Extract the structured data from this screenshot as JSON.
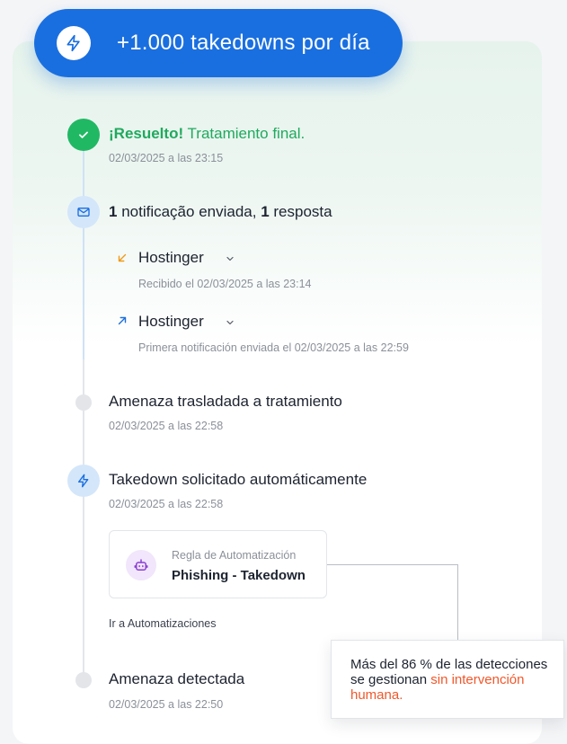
{
  "header": {
    "text": "+1.000 takedowns por día",
    "icon": "lightning-icon",
    "color": "#1a6fe0"
  },
  "timeline": {
    "resolved": {
      "strong": "¡Resuelto!",
      "rest": " Tratamiento final.",
      "date": "02/03/2025 a las 23:15",
      "color": "#1faa5e"
    },
    "notification": {
      "count1": "1",
      "mid": " notificação enviada, ",
      "count2": "1",
      "end": " resposta",
      "items": [
        {
          "direction": "received",
          "provider": "Hostinger",
          "detail": "Recibido el 02/03/2025 a las 23:14"
        },
        {
          "direction": "sent",
          "provider": "Hostinger",
          "detail": "Primera notificación enviada el 02/03/2025 a las 22:59"
        }
      ]
    },
    "moved": {
      "title": "Amenaza trasladada a tratamiento",
      "date": "02/03/2025 a las 22:58"
    },
    "takedown": {
      "title": "Takedown solicitado automáticamente",
      "date": "02/03/2025 a las 22:58",
      "rule_label": "Regla de Automatización",
      "rule_name": "Phishing - Takedown",
      "link": "Ir a Automatizaciones"
    },
    "detected": {
      "title": "Amenaza detectada",
      "date": "02/03/2025 a las 22:50"
    }
  },
  "tooltip": {
    "line": "Más del 86 % de las detecciones se gestionan ",
    "highlight": "sin intervención humana.",
    "highlight_color": "#f0582b"
  }
}
